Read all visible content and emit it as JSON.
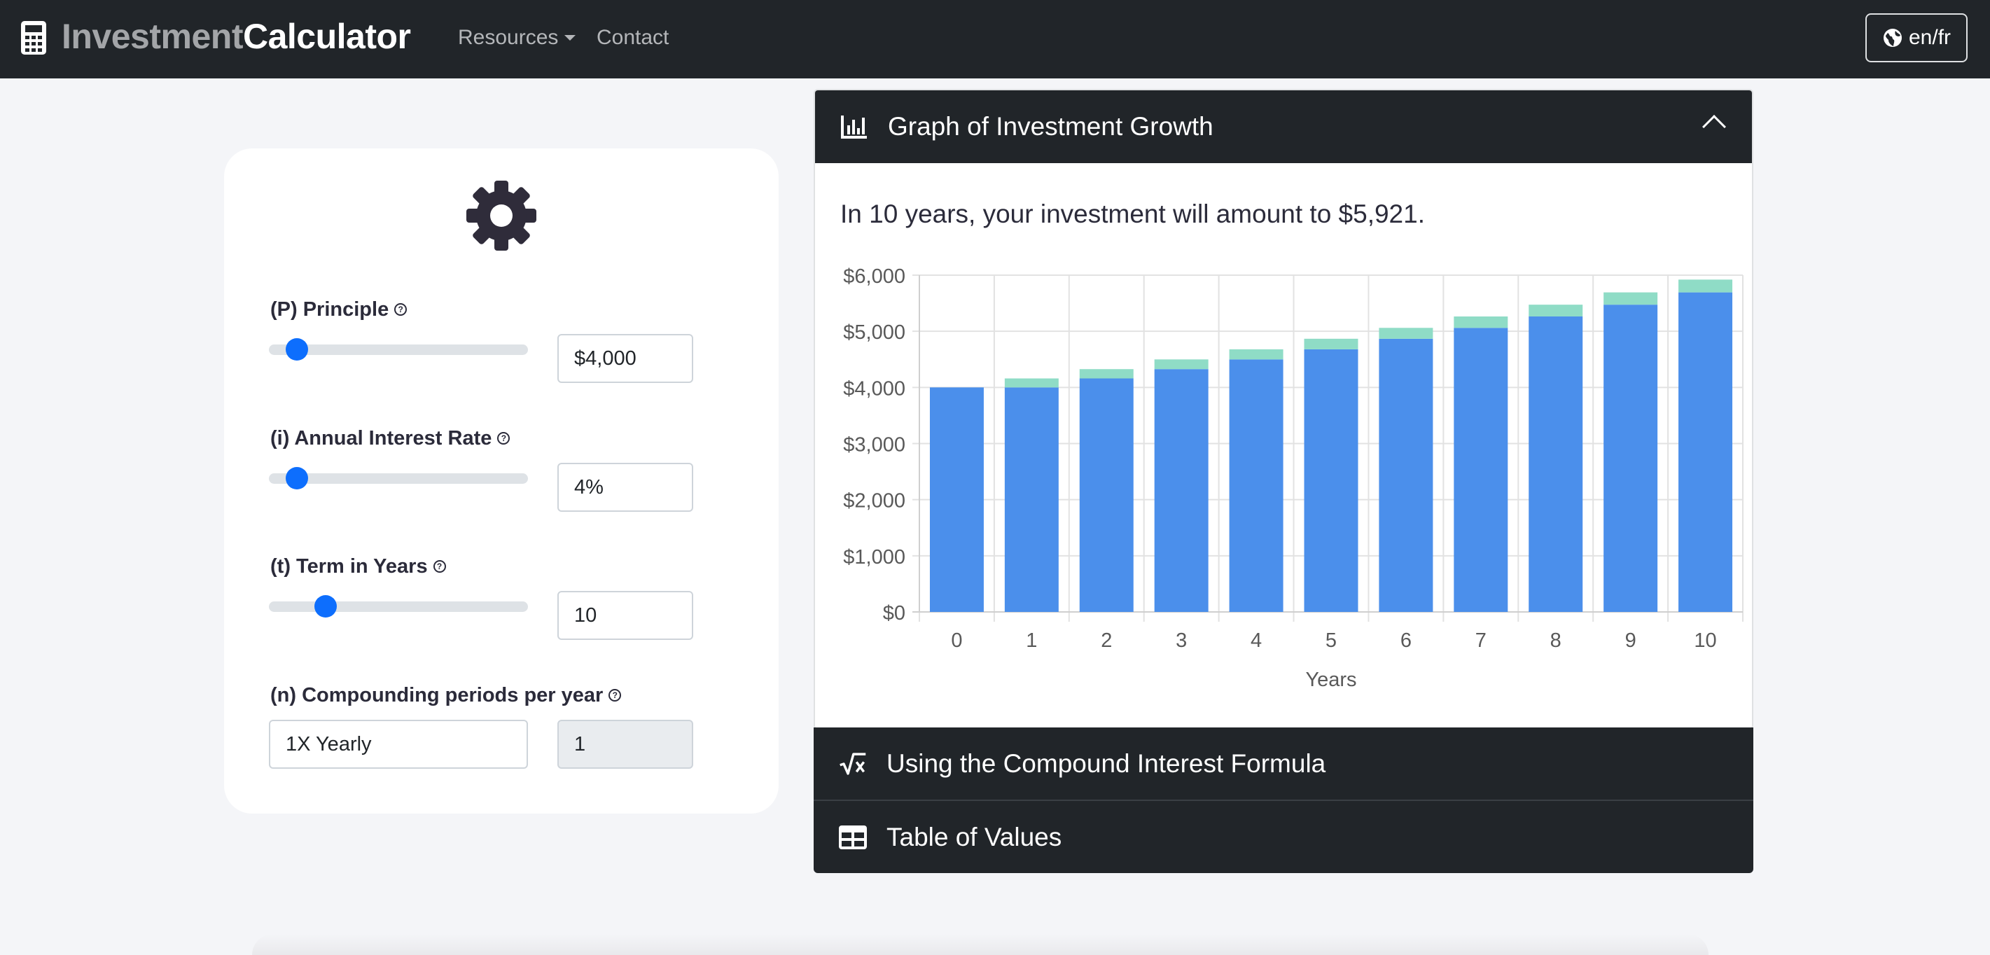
{
  "navbar": {
    "brand_part1": "Investment",
    "brand_part2": "Calculator",
    "brand_icon": "calculator-icon",
    "links": [
      "Resources",
      "Contact"
    ],
    "lang_label": "en/fr",
    "lang_icon": "globe-icon"
  },
  "settings": {
    "icon": "gear-icon",
    "principle": {
      "label": "(P) Principle",
      "value": "$4,000",
      "slider_fraction": 0.06
    },
    "rate": {
      "label": "(i) Annual Interest Rate",
      "value": "4%",
      "slider_fraction": 0.06
    },
    "term": {
      "label": "(t) Term in Years",
      "value": "10",
      "slider_fraction": 0.18
    },
    "compounding": {
      "label": "(n) Compounding periods per year",
      "select_value": "1X Yearly",
      "value": "1"
    }
  },
  "graph_section": {
    "title": "Graph of Investment Growth",
    "icon": "bar-chart-icon",
    "summary": "In 10 years, your investment will amount to $5,921."
  },
  "formula_section": {
    "title": "Using the Compound Interest Formula",
    "icon": "square-root-icon"
  },
  "table_section": {
    "title": "Table of Values",
    "icon": "table-icon"
  },
  "colors": {
    "principal_bar": "#4b8feb",
    "interest_bar": "#8fdcc6",
    "navbar": "#212529",
    "accent": "#0d6efd"
  },
  "chart_data": {
    "type": "bar",
    "stacked": true,
    "categories": [
      "0",
      "1",
      "2",
      "3",
      "4",
      "5",
      "6",
      "7",
      "8",
      "9",
      "10"
    ],
    "series": [
      {
        "values": [
          4000,
          4000,
          4160,
          4326,
          4499,
          4679,
          4867,
          5061,
          5264,
          5474,
          5693
        ]
      },
      {
        "values": [
          0,
          160,
          166,
          173,
          180,
          188,
          194,
          203,
          210,
          219,
          228
        ]
      }
    ],
    "xlabel": "Years",
    "ylabel": "",
    "ylim": [
      0,
      6000
    ],
    "yticks": [
      "$0",
      "$1,000",
      "$2,000",
      "$3,000",
      "$4,000",
      "$5,000",
      "$6,000"
    ],
    "grid": true
  }
}
